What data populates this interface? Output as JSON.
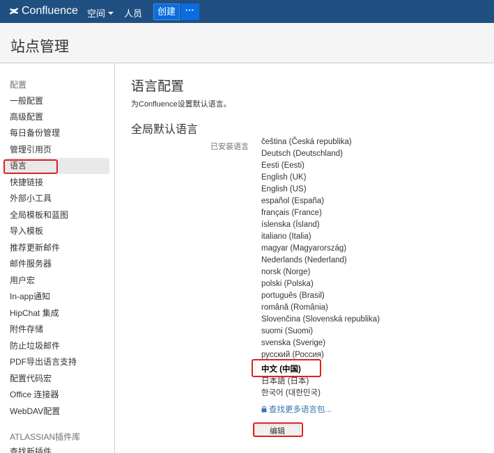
{
  "topnav": {
    "logo_text": "Confluence",
    "spaces_label": "空间",
    "people_label": "人员",
    "create_label": "创建",
    "more_label": "···"
  },
  "page": {
    "title": "站点管理"
  },
  "sidebar": {
    "items": [
      {
        "label": "配置",
        "section": true
      },
      {
        "label": "一般配置"
      },
      {
        "label": "高级配置"
      },
      {
        "label": "每日备份管理"
      },
      {
        "label": "管理引用页"
      },
      {
        "label": "语言",
        "selected": true
      },
      {
        "label": "快捷链接"
      },
      {
        "label": "外部小工具"
      },
      {
        "label": "全局模板和蓝图"
      },
      {
        "label": "导入模板"
      },
      {
        "label": "推荐更新邮件"
      },
      {
        "label": "邮件服务器"
      },
      {
        "label": "用户宏"
      },
      {
        "label": "In-app通知"
      },
      {
        "label": "HipChat 集成"
      },
      {
        "label": "附件存储"
      },
      {
        "label": "防止垃圾邮件"
      },
      {
        "label": "PDF导出语言支持"
      },
      {
        "label": "配置代码宏"
      },
      {
        "label": "Office 连接器"
      },
      {
        "label": "WebDAV配置"
      },
      {
        "label": "ATLASSIAN插件库",
        "section": true
      },
      {
        "label": "查找新插件"
      }
    ]
  },
  "main": {
    "title": "语言配置",
    "description": "为Confluence设置默认语言。",
    "subtitle": "全局默认语言",
    "installed_label": "已安装语言",
    "languages": [
      "čeština (Česká republika)",
      "Deutsch (Deutschland)",
      "Eesti (Eesti)",
      "English (UK)",
      "English (US)",
      "español (España)",
      "français (France)",
      "íslenska (Ísland)",
      "italiano (Italia)",
      "magyar (Magyarország)",
      "Nederlands (Nederland)",
      "norsk (Norge)",
      "polski (Polska)",
      "português (Brasil)",
      "română (România)",
      "Slovenčina (Slovenská republika)",
      "suomi (Suomi)",
      "svenska (Sverige)",
      "русский (Россия)",
      "中文 (中国)",
      "日本語 (日本)",
      "한국어 (대한민국)"
    ],
    "selected_language": "中文 (中国)",
    "find_more_label": "查找更多语言包...",
    "edit_label": "编辑"
  },
  "colors": {
    "nav_bg": "#205081",
    "create_btn": "#0b6ce0",
    "highlight": "#e02020",
    "link": "#3572b0"
  }
}
